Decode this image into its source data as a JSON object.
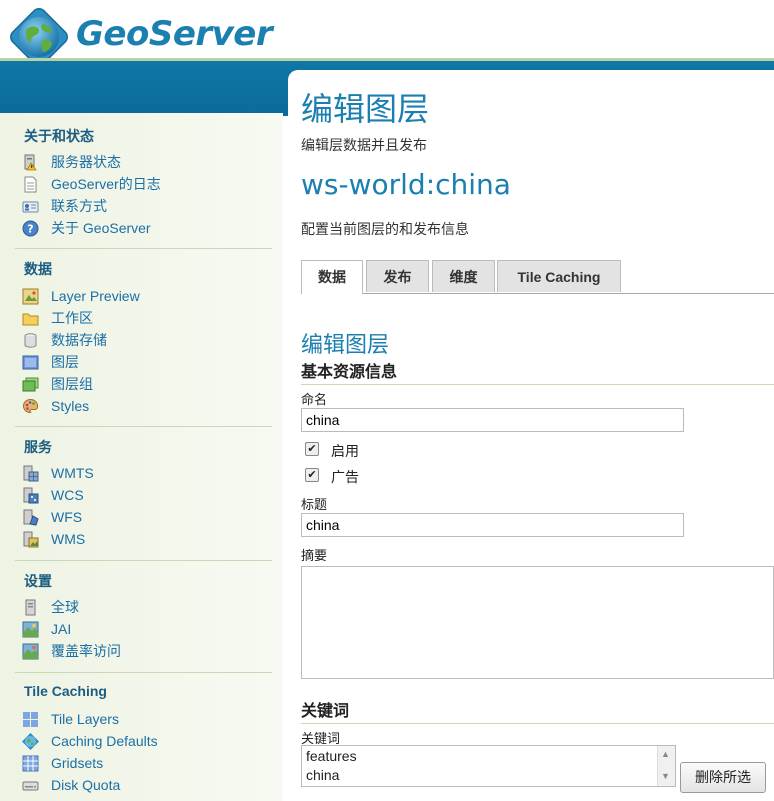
{
  "app": {
    "name": "GeoServer"
  },
  "sidebar": {
    "sections": [
      {
        "heading": "关于和状态",
        "items": [
          {
            "label": "服务器状态",
            "icon": "server-status-icon"
          },
          {
            "label": "GeoServer的日志",
            "icon": "log-icon"
          },
          {
            "label": "联系方式",
            "icon": "contact-card-icon"
          },
          {
            "label": "关于 GeoServer",
            "icon": "help-icon"
          }
        ]
      },
      {
        "heading": "数据",
        "items": [
          {
            "label": "Layer Preview",
            "icon": "layer-preview-icon"
          },
          {
            "label": "工作区",
            "icon": "folder-icon"
          },
          {
            "label": "数据存储",
            "icon": "database-icon"
          },
          {
            "label": "图层",
            "icon": "layer-icon"
          },
          {
            "label": "图层组",
            "icon": "layer-group-icon"
          },
          {
            "label": "Styles",
            "icon": "palette-icon"
          }
        ]
      },
      {
        "heading": "服务",
        "items": [
          {
            "label": "WMTS",
            "icon": "wmts-service-icon"
          },
          {
            "label": "WCS",
            "icon": "wcs-service-icon"
          },
          {
            "label": "WFS",
            "icon": "wfs-service-icon"
          },
          {
            "label": "WMS",
            "icon": "wms-service-icon"
          }
        ]
      },
      {
        "heading": "设置",
        "items": [
          {
            "label": "全球",
            "icon": "global-settings-icon"
          },
          {
            "label": "JAI",
            "icon": "jai-icon"
          },
          {
            "label": "覆盖率访问",
            "icon": "coverage-access-icon"
          }
        ]
      },
      {
        "heading": "Tile Caching",
        "items": [
          {
            "label": "Tile Layers",
            "icon": "tile-layers-icon"
          },
          {
            "label": "Caching Defaults",
            "icon": "globe-icon"
          },
          {
            "label": "Gridsets",
            "icon": "grid-icon"
          },
          {
            "label": "Disk Quota",
            "icon": "disk-icon"
          }
        ]
      }
    ]
  },
  "main": {
    "title": "编辑图层",
    "subtitle": "编辑层数据并且发布",
    "layer_name": "ws-world:china",
    "layer_desc": "配置当前图层的和发布信息",
    "tabs": [
      {
        "label": "数据",
        "active": true
      },
      {
        "label": "发布",
        "active": false
      },
      {
        "label": "维度",
        "active": false
      },
      {
        "label": "Tile Caching",
        "active": false
      }
    ],
    "section_title": "编辑图层",
    "basic_info_heading": "基本资源信息",
    "name_label": "命名",
    "name_value": "china",
    "enabled_label": "启用",
    "enabled_checked": true,
    "advertised_label": "广告",
    "advertised_checked": true,
    "title_label": "标题",
    "title_value": "china",
    "abstract_label": "摘要",
    "abstract_value": "",
    "keywords_heading": "关键词",
    "keywords_label": "关键词",
    "keywords": [
      "features",
      "china"
    ],
    "remove_selected_label": "删除所选"
  },
  "colors": {
    "brand": "#1b7fb0",
    "header_bar": "#0f77a6",
    "sidebar_bg": "#f4f8ec",
    "link": "#1b6fa6"
  }
}
